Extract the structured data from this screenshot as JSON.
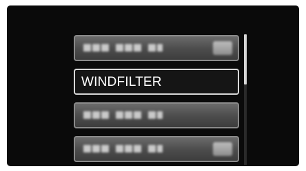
{
  "menu": {
    "items": [
      {
        "label": "",
        "blurred": true,
        "has_icon": true
      },
      {
        "label": "WINDFILTER",
        "selected": true
      },
      {
        "label": "",
        "blurred": true,
        "has_icon": false
      },
      {
        "label": "",
        "blurred": true,
        "has_icon": true
      }
    ]
  },
  "scrollbar": {
    "position_fraction": 0.0,
    "visible_fraction": 0.38
  },
  "colors": {
    "background": "#0a0a0a",
    "item_highlight_border": "#d8d8d8",
    "text": "#ffffff"
  }
}
